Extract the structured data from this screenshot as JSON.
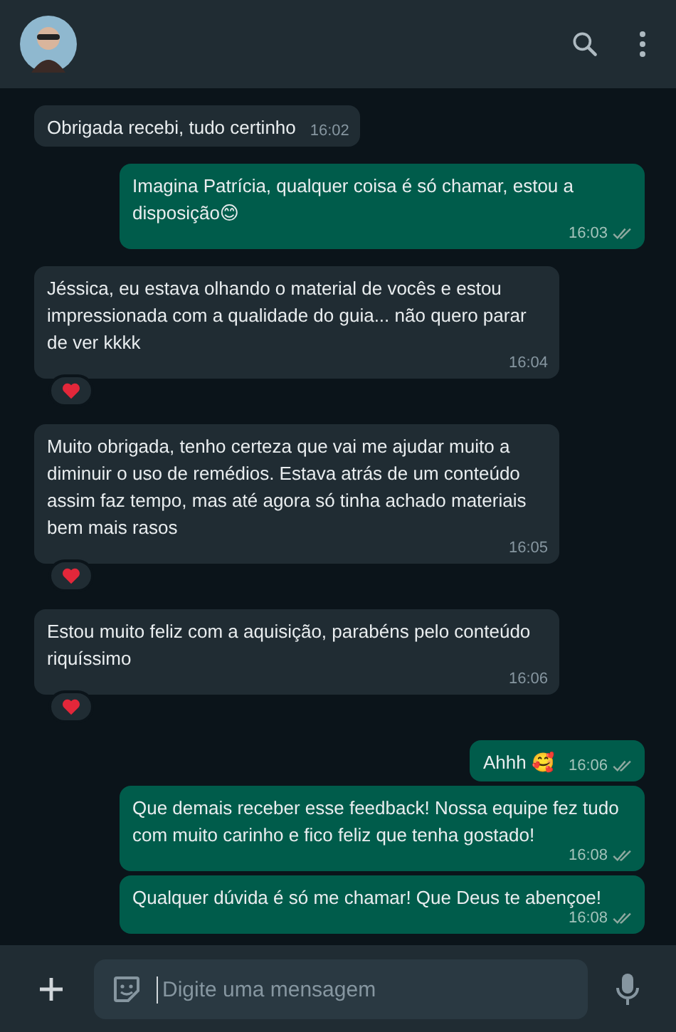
{
  "messages": [
    {
      "kind": "incoming",
      "text": "Obrigada recebi, tudo certinho",
      "time": "16:02"
    },
    {
      "kind": "outgoing",
      "text": "Imagina Patrícia, qualquer coisa é só chamar, estou a disposição😊",
      "time": "16:03",
      "delivered": true
    },
    {
      "kind": "incoming",
      "text": "Jéssica, eu estava olhando o material de vocês e estou impressionada com a qualidade do guia... não quero parar de ver kkkk",
      "time": "16:04",
      "hearted": true
    },
    {
      "kind": "incoming",
      "text": "Muito obrigada, tenho certeza que vai me ajudar muito a diminuir o uso de remédios. Estava atrás de um conteúdo assim faz tempo, mas até agora só tinha achado materiais bem mais rasos",
      "time": "16:05",
      "hearted": true
    },
    {
      "kind": "incoming",
      "text": "Estou muito feliz com a aquisição, parabéns pelo conteúdo riquíssimo",
      "time": "16:06",
      "hearted": true
    },
    {
      "kind": "outgoing",
      "text": "Ahhh 🥰",
      "time": "16:06",
      "delivered": true
    },
    {
      "kind": "outgoing",
      "text": "Que demais receber esse feedback! Nossa equipe fez tudo com muito carinho e fico feliz que tenha gostado!",
      "time": "16:08",
      "delivered": true
    },
    {
      "kind": "outgoing",
      "text": "Qualquer dúvida é só me chamar! Que Deus te abençoe!",
      "time": "16:08",
      "delivered": true
    }
  ],
  "composer": {
    "placeholder": "Digite uma mensagem"
  }
}
